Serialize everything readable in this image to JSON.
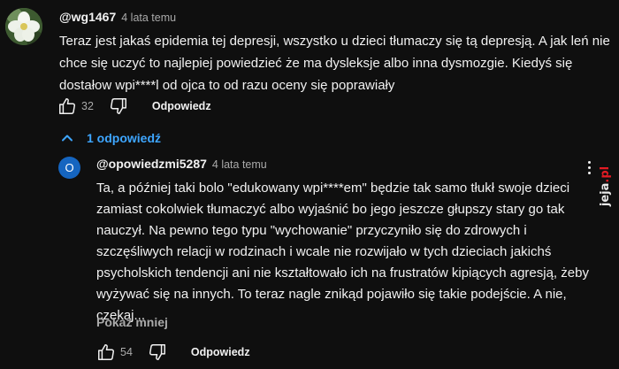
{
  "comment": {
    "author": "@wg1467",
    "time": "4 lata temu",
    "text": "Teraz jest jakaś epidemia tej depresji, wszystko u dzieci tłumaczy się tą depresją. A jak leń nie chce się uczyć to najlepiej powiedzieć że ma dysleksje albo inna dysmozgie. Kiedyś się dostałow wpi****l od ojca to od razu oceny się poprawiały",
    "likes": "32",
    "reply_label": "Odpowiedz",
    "replies_toggle": "1 odpowiedź"
  },
  "reply": {
    "avatar_letter": "O",
    "author": "@opowiedzmi5287",
    "time": "4 lata temu",
    "text": "Ta, a później taki bolo \"edukowany wpi****em\" będzie tak samo tłukł swoje dzieci zamiast cokolwiek tłumaczyć albo wyjaśnić bo jego jeszcze głupszy stary go tak nauczył. Na pewno tego typu \"wychowanie\" przyczyniło się do zdrowych i szczęśliwych relacji w rodzinach i wcale nie rozwijało w tych dzieciach jakichś psycholskich tendencji ani nie kształtowało ich na frustratów kipiących agresją, żeby wyżywać się na innych. To teraz nagle znikąd pojawiło się takie podejście. A nie, czekaj...",
    "show_less": "Pokaż mniej",
    "likes": "54",
    "reply_label": "Odpowiedz"
  },
  "watermark": {
    "text_main": "jeja",
    "text_suffix": ".pl"
  },
  "colors": {
    "background": "#0f0f0f",
    "link_blue": "#3ea6ff",
    "reply_avatar": "#1565c0"
  }
}
